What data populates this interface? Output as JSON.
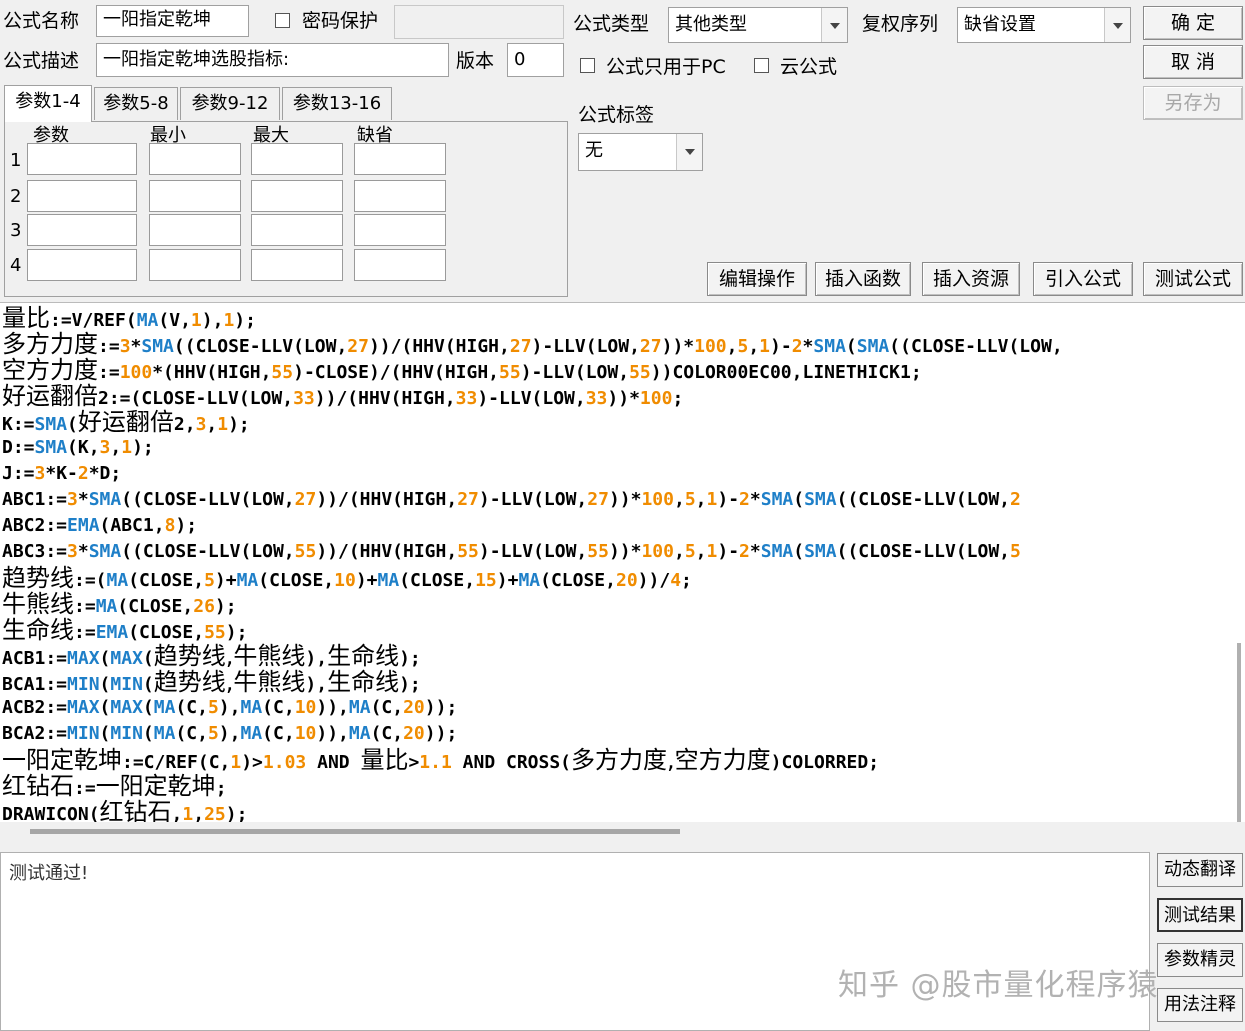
{
  "header": {
    "name_label": "公式名称",
    "name_value": "一阳指定乾坤",
    "password_label": "密码保护",
    "desc_label": "公式描述",
    "desc_value": "一阳指定乾坤选股指标:",
    "version_label": "版本",
    "version_value": "0",
    "type_label": "公式类型",
    "type_value": "其他类型",
    "restore_label": "复权序列",
    "restore_value": "缺省设置",
    "pc_only_label": "公式只用于PC",
    "cloud_label": "云公式",
    "tag_label": "公式标签",
    "tag_value": "无"
  },
  "buttons": {
    "ok": "确  定",
    "cancel": "取  消",
    "save_as": "另存为"
  },
  "tabs": [
    "参数1-4",
    "参数5-8",
    "参数9-12",
    "参数13-16"
  ],
  "params": {
    "headers": [
      "参数",
      "最小",
      "最大",
      "缺省"
    ],
    "rows": [
      "1",
      "2",
      "3",
      "4"
    ]
  },
  "toolbar": [
    "编辑操作",
    "插入函数",
    "插入资源",
    "引入公式",
    "测试公式"
  ],
  "code_lines": [
    [
      {
        "t": "量比",
        "c": "cjk"
      },
      {
        "t": ":=V/REF("
      },
      {
        "t": "MA",
        "c": "fn"
      },
      {
        "t": "(V,"
      },
      {
        "t": "1",
        "c": "num"
      },
      {
        "t": "),"
      },
      {
        "t": "1",
        "c": "num"
      },
      {
        "t": ");"
      }
    ],
    [
      {
        "t": "多方力度",
        "c": "cjk"
      },
      {
        "t": ":="
      },
      {
        "t": "3",
        "c": "num"
      },
      {
        "t": "*"
      },
      {
        "t": "SMA",
        "c": "fn"
      },
      {
        "t": "((CLOSE-LLV(LOW,"
      },
      {
        "t": "27",
        "c": "num"
      },
      {
        "t": "))/(HHV(HIGH,"
      },
      {
        "t": "27",
        "c": "num"
      },
      {
        "t": ")-LLV(LOW,"
      },
      {
        "t": "27",
        "c": "num"
      },
      {
        "t": "))*"
      },
      {
        "t": "100",
        "c": "num"
      },
      {
        "t": ","
      },
      {
        "t": "5",
        "c": "num"
      },
      {
        "t": ","
      },
      {
        "t": "1",
        "c": "num"
      },
      {
        "t": ")-"
      },
      {
        "t": "2",
        "c": "num"
      },
      {
        "t": "*"
      },
      {
        "t": "SMA",
        "c": "fn"
      },
      {
        "t": "("
      },
      {
        "t": "SMA",
        "c": "fn"
      },
      {
        "t": "((CLOSE-LLV(LOW,"
      }
    ],
    [
      {
        "t": "空方力度",
        "c": "cjk"
      },
      {
        "t": ":="
      },
      {
        "t": "100",
        "c": "num"
      },
      {
        "t": "*(HHV(HIGH,"
      },
      {
        "t": "55",
        "c": "num"
      },
      {
        "t": ")-CLOSE)/(HHV(HIGH,"
      },
      {
        "t": "55",
        "c": "num"
      },
      {
        "t": ")-LLV(LOW,"
      },
      {
        "t": "55",
        "c": "num"
      },
      {
        "t": "))COLOR00EC00,LINETHICK1;"
      }
    ],
    [
      {
        "t": "好运翻倍",
        "c": "cjk"
      },
      {
        "t": "2:=(CLOSE-LLV(LOW,"
      },
      {
        "t": "33",
        "c": "num"
      },
      {
        "t": "))/(HHV(HIGH,"
      },
      {
        "t": "33",
        "c": "num"
      },
      {
        "t": ")-LLV(LOW,"
      },
      {
        "t": "33",
        "c": "num"
      },
      {
        "t": "))*"
      },
      {
        "t": "100",
        "c": "num"
      },
      {
        "t": ";"
      }
    ],
    [
      {
        "t": "K:="
      },
      {
        "t": "SMA",
        "c": "fn"
      },
      {
        "t": "("
      },
      {
        "t": "好运翻倍",
        "c": "cjk"
      },
      {
        "t": "2,"
      },
      {
        "t": "3",
        "c": "num"
      },
      {
        "t": ","
      },
      {
        "t": "1",
        "c": "num"
      },
      {
        "t": ");"
      }
    ],
    [
      {
        "t": "D:="
      },
      {
        "t": "SMA",
        "c": "fn"
      },
      {
        "t": "(K,"
      },
      {
        "t": "3",
        "c": "num"
      },
      {
        "t": ","
      },
      {
        "t": "1",
        "c": "num"
      },
      {
        "t": ");"
      }
    ],
    [
      {
        "t": "J:="
      },
      {
        "t": "3",
        "c": "num"
      },
      {
        "t": "*K-"
      },
      {
        "t": "2",
        "c": "num"
      },
      {
        "t": "*D;"
      }
    ],
    [
      {
        "t": "ABC1:="
      },
      {
        "t": "3",
        "c": "num"
      },
      {
        "t": "*"
      },
      {
        "t": "SMA",
        "c": "fn"
      },
      {
        "t": "((CLOSE-LLV(LOW,"
      },
      {
        "t": "27",
        "c": "num"
      },
      {
        "t": "))/(HHV(HIGH,"
      },
      {
        "t": "27",
        "c": "num"
      },
      {
        "t": ")-LLV(LOW,"
      },
      {
        "t": "27",
        "c": "num"
      },
      {
        "t": "))*"
      },
      {
        "t": "100",
        "c": "num"
      },
      {
        "t": ","
      },
      {
        "t": "5",
        "c": "num"
      },
      {
        "t": ","
      },
      {
        "t": "1",
        "c": "num"
      },
      {
        "t": ")-"
      },
      {
        "t": "2",
        "c": "num"
      },
      {
        "t": "*"
      },
      {
        "t": "SMA",
        "c": "fn"
      },
      {
        "t": "("
      },
      {
        "t": "SMA",
        "c": "fn"
      },
      {
        "t": "((CLOSE-LLV(LOW,"
      },
      {
        "t": "2",
        "c": "num"
      }
    ],
    [
      {
        "t": "ABC2:="
      },
      {
        "t": "EMA",
        "c": "fn"
      },
      {
        "t": "(ABC1,"
      },
      {
        "t": "8",
        "c": "num"
      },
      {
        "t": ");"
      }
    ],
    [
      {
        "t": "ABC3:="
      },
      {
        "t": "3",
        "c": "num"
      },
      {
        "t": "*"
      },
      {
        "t": "SMA",
        "c": "fn"
      },
      {
        "t": "((CLOSE-LLV(LOW,"
      },
      {
        "t": "55",
        "c": "num"
      },
      {
        "t": "))/(HHV(HIGH,"
      },
      {
        "t": "55",
        "c": "num"
      },
      {
        "t": ")-LLV(LOW,"
      },
      {
        "t": "55",
        "c": "num"
      },
      {
        "t": "))*"
      },
      {
        "t": "100",
        "c": "num"
      },
      {
        "t": ","
      },
      {
        "t": "5",
        "c": "num"
      },
      {
        "t": ","
      },
      {
        "t": "1",
        "c": "num"
      },
      {
        "t": ")-"
      },
      {
        "t": "2",
        "c": "num"
      },
      {
        "t": "*"
      },
      {
        "t": "SMA",
        "c": "fn"
      },
      {
        "t": "("
      },
      {
        "t": "SMA",
        "c": "fn"
      },
      {
        "t": "((CLOSE-LLV(LOW,"
      },
      {
        "t": "5",
        "c": "num"
      }
    ],
    [
      {
        "t": "趋势线",
        "c": "cjk"
      },
      {
        "t": ":=("
      },
      {
        "t": "MA",
        "c": "fn"
      },
      {
        "t": "(CLOSE,"
      },
      {
        "t": "5",
        "c": "num"
      },
      {
        "t": ")+"
      },
      {
        "t": "MA",
        "c": "fn"
      },
      {
        "t": "(CLOSE,"
      },
      {
        "t": "10",
        "c": "num"
      },
      {
        "t": ")+"
      },
      {
        "t": "MA",
        "c": "fn"
      },
      {
        "t": "(CLOSE,"
      },
      {
        "t": "15",
        "c": "num"
      },
      {
        "t": ")+"
      },
      {
        "t": "MA",
        "c": "fn"
      },
      {
        "t": "(CLOSE,"
      },
      {
        "t": "20",
        "c": "num"
      },
      {
        "t": "))/"
      },
      {
        "t": "4",
        "c": "num"
      },
      {
        "t": ";"
      }
    ],
    [
      {
        "t": "牛熊线",
        "c": "cjk"
      },
      {
        "t": ":="
      },
      {
        "t": "MA",
        "c": "fn"
      },
      {
        "t": "(CLOSE,"
      },
      {
        "t": "26",
        "c": "num"
      },
      {
        "t": ");"
      }
    ],
    [
      {
        "t": "生命线",
        "c": "cjk"
      },
      {
        "t": ":="
      },
      {
        "t": "EMA",
        "c": "fn"
      },
      {
        "t": "(CLOSE,"
      },
      {
        "t": "55",
        "c": "num"
      },
      {
        "t": ");"
      }
    ],
    [
      {
        "t": "ACB1:="
      },
      {
        "t": "MAX",
        "c": "fn"
      },
      {
        "t": "("
      },
      {
        "t": "MAX",
        "c": "fn"
      },
      {
        "t": "("
      },
      {
        "t": "趋势线,牛熊线",
        "c": "cjk"
      },
      {
        "t": "),"
      },
      {
        "t": "生命线",
        "c": "cjk"
      },
      {
        "t": ");"
      }
    ],
    [
      {
        "t": "BCA1:="
      },
      {
        "t": "MIN",
        "c": "fn"
      },
      {
        "t": "("
      },
      {
        "t": "MIN",
        "c": "fn"
      },
      {
        "t": "("
      },
      {
        "t": "趋势线,牛熊线",
        "c": "cjk"
      },
      {
        "t": "),"
      },
      {
        "t": "生命线",
        "c": "cjk"
      },
      {
        "t": ");"
      }
    ],
    [
      {
        "t": "ACB2:="
      },
      {
        "t": "MAX",
        "c": "fn"
      },
      {
        "t": "("
      },
      {
        "t": "MAX",
        "c": "fn"
      },
      {
        "t": "("
      },
      {
        "t": "MA",
        "c": "fn"
      },
      {
        "t": "(C,"
      },
      {
        "t": "5",
        "c": "num"
      },
      {
        "t": "),"
      },
      {
        "t": "MA",
        "c": "fn"
      },
      {
        "t": "(C,"
      },
      {
        "t": "10",
        "c": "num"
      },
      {
        "t": ")),"
      },
      {
        "t": "MA",
        "c": "fn"
      },
      {
        "t": "(C,"
      },
      {
        "t": "20",
        "c": "num"
      },
      {
        "t": "));"
      }
    ],
    [
      {
        "t": "BCA2:="
      },
      {
        "t": "MIN",
        "c": "fn"
      },
      {
        "t": "("
      },
      {
        "t": "MIN",
        "c": "fn"
      },
      {
        "t": "("
      },
      {
        "t": "MA",
        "c": "fn"
      },
      {
        "t": "(C,"
      },
      {
        "t": "5",
        "c": "num"
      },
      {
        "t": "),"
      },
      {
        "t": "MA",
        "c": "fn"
      },
      {
        "t": "(C,"
      },
      {
        "t": "10",
        "c": "num"
      },
      {
        "t": ")),"
      },
      {
        "t": "MA",
        "c": "fn"
      },
      {
        "t": "(C,"
      },
      {
        "t": "20",
        "c": "num"
      },
      {
        "t": "));"
      }
    ],
    [
      {
        "t": "一阳定乾坤",
        "c": "cjk"
      },
      {
        "t": ":=C/REF(C,"
      },
      {
        "t": "1",
        "c": "num"
      },
      {
        "t": ")>"
      },
      {
        "t": "1.03",
        "c": "num"
      },
      {
        "t": " AND "
      },
      {
        "t": "量比",
        "c": "cjk"
      },
      {
        "t": ">"
      },
      {
        "t": "1.1",
        "c": "num"
      },
      {
        "t": " AND CROSS("
      },
      {
        "t": "多方力度,空方力度",
        "c": "cjk"
      },
      {
        "t": ")COLORRED;"
      }
    ],
    [
      {
        "t": "红钻石",
        "c": "cjk"
      },
      {
        "t": ":="
      },
      {
        "t": "一阳定乾坤",
        "c": "cjk"
      },
      {
        "t": ";"
      }
    ],
    [
      {
        "t": "DRAWICON("
      },
      {
        "t": "红钻石",
        "c": "cjk"
      },
      {
        "t": ","
      },
      {
        "t": "1",
        "c": "num"
      },
      {
        "t": ","
      },
      {
        "t": "25",
        "c": "num"
      },
      {
        "t": ");"
      }
    ]
  ],
  "output_text": "测试通过!",
  "side_buttons": [
    "动态翻译",
    "测试结果",
    "参数精灵",
    "用法注释"
  ],
  "watermark": "知乎 @股市量化程序猿",
  "colors": {
    "function": "#1e7fc8",
    "number": "#f08c00"
  }
}
